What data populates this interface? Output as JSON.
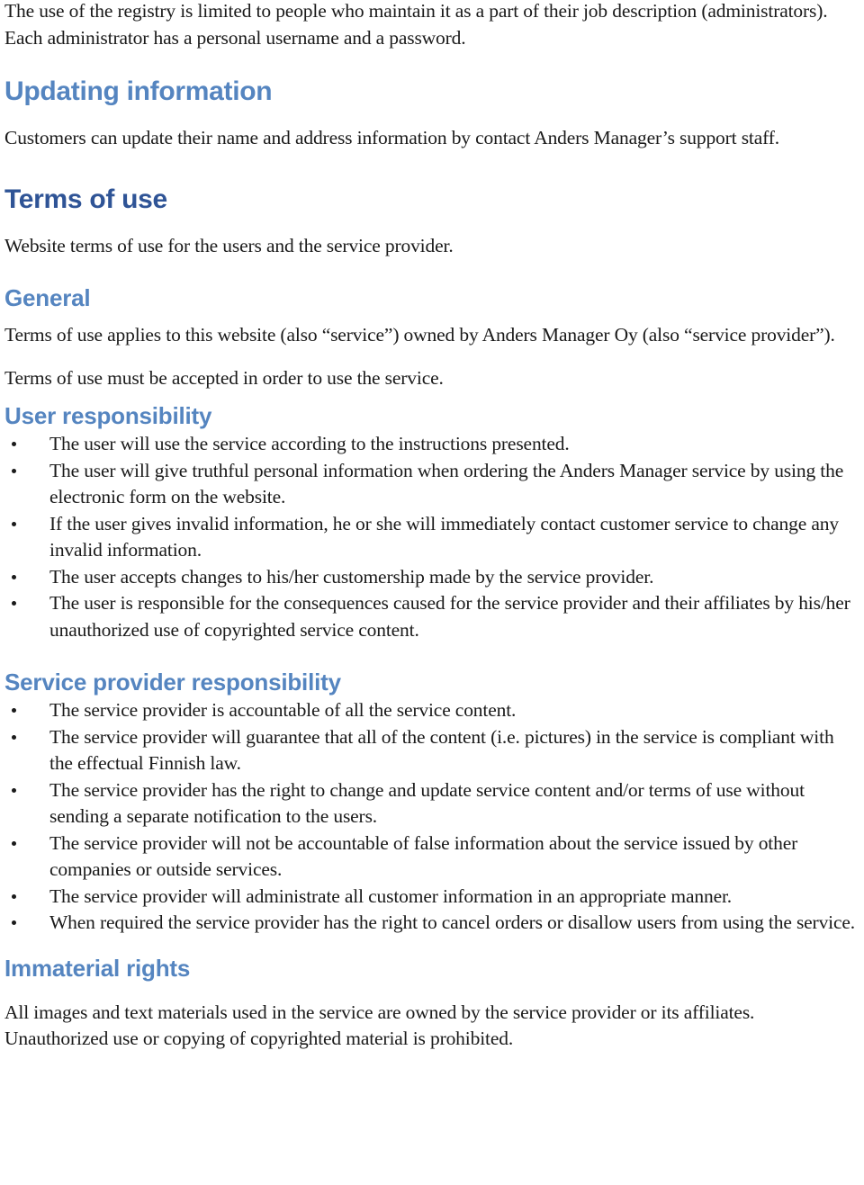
{
  "page": {
    "colors": {
      "heading_primary": "#2F5496",
      "heading_secondary": "#5585C0",
      "body_text": "#1a1a1a",
      "background": "#ffffff"
    }
  },
  "intro": {
    "paragraph": "The use of the registry is limited to people who maintain it as a part of their job description (administrators). Each administrator has a personal username and a password."
  },
  "sections": {
    "updating_information": {
      "heading": "Updating information",
      "paragraph": "Customers can update their name and address information by contact Anders Manager’s support staff."
    },
    "terms_of_use": {
      "heading": "Terms of use",
      "paragraph": "Website terms of use for the users and the service provider."
    },
    "general": {
      "heading": "General",
      "paragraph_1": "Terms of use applies to this website (also “service”) owned by Anders Manager Oy (also “service provider”).",
      "paragraph_2": "Terms of use must be accepted in order to use the service."
    },
    "user_responsibility": {
      "heading": "User responsibility",
      "bullets": [
        "The user will use the service according to the instructions presented.",
        "The user will give truthful personal information when ordering the Anders Manager service by using the electronic form on the website.",
        "If the user gives invalid information, he or she will immediately contact customer service to change any invalid information.",
        "The user accepts changes to his/her customership made by the service provider.",
        "The user is responsible for the consequences caused for the service provider and their affiliates by his/her unauthorized use of copyrighted service content."
      ]
    },
    "service_provider_responsibility": {
      "heading": "Service provider responsibility",
      "bullets": [
        "The service provider is accountable of all the service content.",
        "The service provider will guarantee that all of the content (i.e. pictures) in the service is compliant with the effectual Finnish law.",
        "The service provider has the right to change and update service content and/or terms of use without sending a separate notification to the users.",
        "The service provider will not be accountable of false information about the service issued by other companies or outside services.",
        "The service provider will administrate all customer information in an appropriate manner.",
        "When required the service provider has the right to cancel orders or disallow users from using the service."
      ]
    },
    "immaterial_rights": {
      "heading": "Immaterial rights",
      "paragraph": "All images and text materials used in the service are owned by the service provider or its affiliates. Unauthorized use or copying of copyrighted material is prohibited."
    }
  }
}
